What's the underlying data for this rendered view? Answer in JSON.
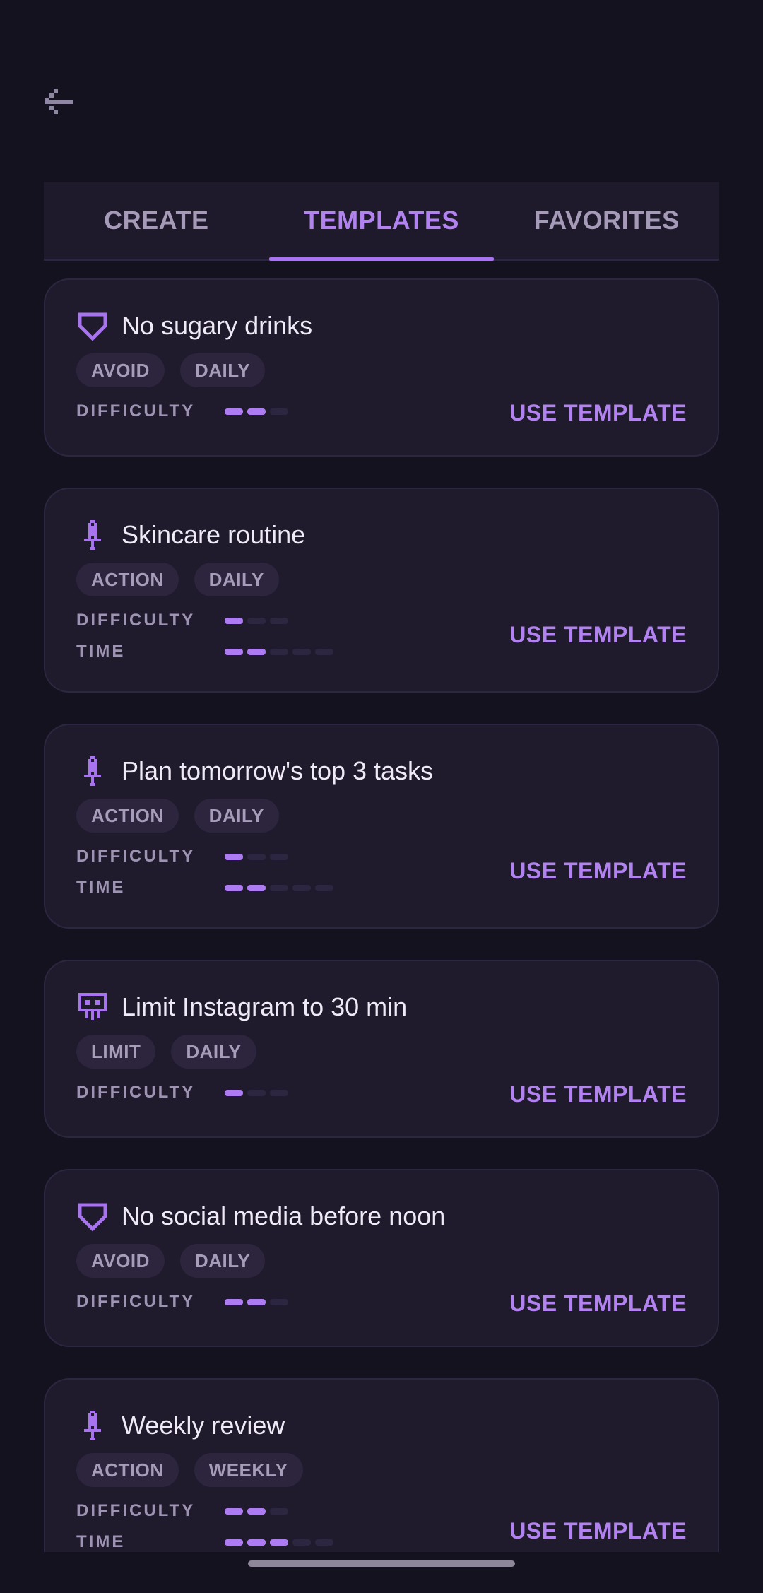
{
  "nav": {
    "back_icon": "back-arrow-icon"
  },
  "tabs": [
    {
      "label": "CREATE",
      "active": false
    },
    {
      "label": "TEMPLATES",
      "active": true
    },
    {
      "label": "FAVORITES",
      "active": false
    }
  ],
  "labels": {
    "difficulty": "DIFFICULTY",
    "time": "TIME",
    "use_template": "USE TEMPLATE"
  },
  "templates": [
    {
      "icon": "shield-icon",
      "title": "No sugary drinks",
      "tags": [
        "AVOID",
        "DAILY"
      ],
      "difficulty": 2,
      "time": null
    },
    {
      "icon": "sword-icon",
      "title": "Skincare routine",
      "tags": [
        "ACTION",
        "DAILY"
      ],
      "difficulty": 1,
      "time": 2
    },
    {
      "icon": "sword-icon",
      "title": "Plan tomorrow's top 3 tasks",
      "tags": [
        "ACTION",
        "DAILY"
      ],
      "difficulty": 1,
      "time": 2
    },
    {
      "icon": "skull-icon",
      "title": "Limit Instagram to 30 min",
      "tags": [
        "LIMIT",
        "DAILY"
      ],
      "difficulty": 1,
      "time": null
    },
    {
      "icon": "shield-icon",
      "title": "No social media before noon",
      "tags": [
        "AVOID",
        "DAILY"
      ],
      "difficulty": 2,
      "time": null
    },
    {
      "icon": "sword-icon",
      "title": "Weekly review",
      "tags": [
        "ACTION",
        "WEEKLY"
      ],
      "difficulty": 2,
      "time": 3
    }
  ],
  "scales": {
    "difficulty_max": 3,
    "time_max": 5
  },
  "colors": {
    "background": "#15121f",
    "card": "#1f1a2c",
    "accent": "#b283f0",
    "chip": "#2c253d"
  }
}
